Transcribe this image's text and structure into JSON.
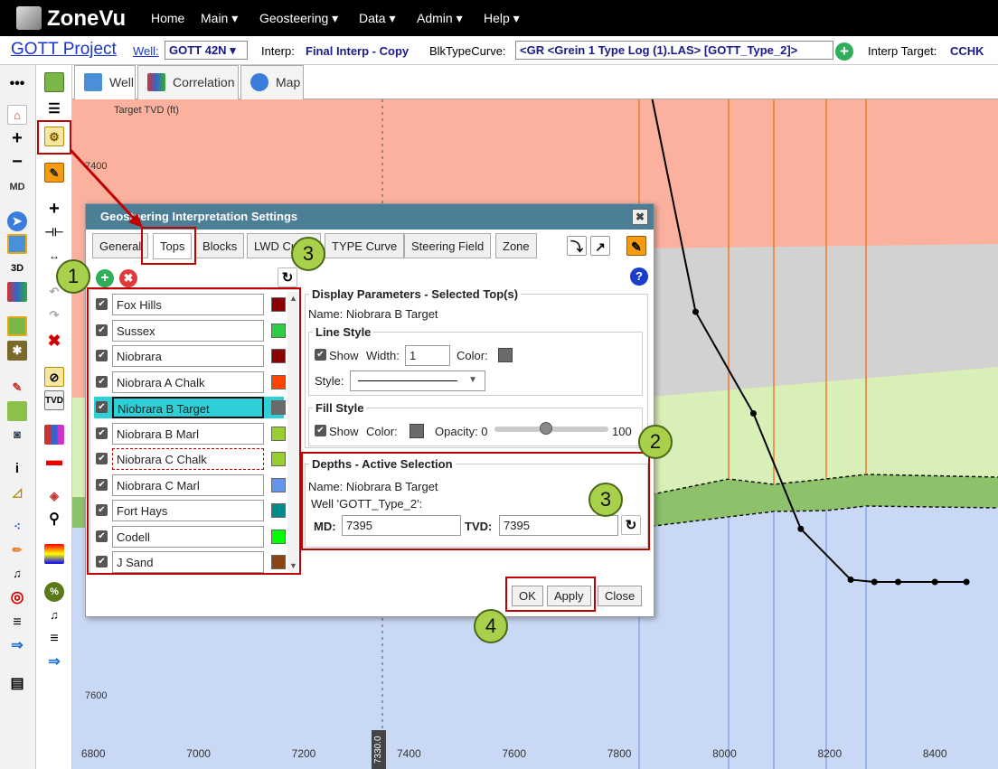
{
  "app": {
    "logo_text": "ZoneVu"
  },
  "nav": {
    "items": [
      "Home",
      "Main ▾",
      "Geosteering ▾",
      "Data ▾",
      "Admin ▾",
      "Help ▾"
    ]
  },
  "project": {
    "title": "GOTT Project",
    "well_label": "Well:",
    "well_value": "GOTT 42N",
    "interp_label": "Interp:",
    "interp_value": "Final Interp - Copy",
    "blk_label": "BlkTypeCurve:",
    "blk_value": "<GR <Grein 1 Type Log (1).LAS> [GOTT_Type_2]>",
    "target_label": "Interp Target:",
    "target_value": "CCHK"
  },
  "view_tabs": [
    "Well",
    "Correlation",
    "Map"
  ],
  "chart": {
    "axis_label": "Target TVD (ft)",
    "y_ticks": [
      "7400",
      "7600"
    ],
    "x_ticks": [
      "6800",
      "7000",
      "7200",
      "7400",
      "7600",
      "7800",
      "8000",
      "8200",
      "8400"
    ],
    "cursor_label": "7330.0",
    "colors": {
      "salmon": "#fbb19e",
      "gray": "#d2d2d2",
      "lightgreen": "#d9efb8",
      "green": "#8ec26a",
      "blue": "#c9d8f4",
      "orange_line": "#f07a2a"
    }
  },
  "chart_data": {
    "type": "line",
    "x": [
      7852,
      7945,
      8055,
      8145,
      8240,
      8285,
      8330,
      8400,
      8460
    ],
    "y": [
      7318,
      7422,
      7466,
      7516,
      7538,
      7539,
      7539,
      7539,
      7539
    ],
    "title": "",
    "xlabel": "",
    "ylabel": "Target TVD (ft)",
    "xlim": [
      6760,
      8520
    ],
    "ylim": [
      7330,
      7620
    ]
  },
  "dialog": {
    "title": "Geosteering Interpretation Settings",
    "close_label": "✖",
    "tabs": [
      "General",
      "Tops",
      "Blocks",
      "LWD Curve",
      "TYPE Curve",
      "Steering Field",
      "Zone"
    ],
    "tops": [
      {
        "name": "Fox Hills",
        "color": "#8b0000"
      },
      {
        "name": "Sussex",
        "color": "#2ecc40"
      },
      {
        "name": "Niobrara",
        "color": "#8b0000"
      },
      {
        "name": "Niobrara A Chalk",
        "color": "#ff4500"
      },
      {
        "name": "Niobrara B Target",
        "color": "#6b6b6b"
      },
      {
        "name": "Niobrara B Marl",
        "color": "#9acd32"
      },
      {
        "name": "Niobrara C Chalk",
        "color": "#9acd32"
      },
      {
        "name": "Niobrara C Marl",
        "color": "#6495ed"
      },
      {
        "name": "Fort Hays",
        "color": "#008b8b"
      },
      {
        "name": "Codell",
        "color": "#00ff00"
      },
      {
        "name": "J Sand",
        "color": "#8b4513"
      }
    ],
    "display": {
      "legend": "Display Parameters - Selected Top(s)",
      "name_line": "Name: Niobrara B Target",
      "line_style_legend": "Line Style",
      "show_label": "Show",
      "width_label": "Width:",
      "width_value": "1",
      "color_label": "Color:",
      "style_label": "Style:",
      "fill_style_legend": "Fill Style",
      "fill_show_label": "Show",
      "fill_color_label": "Color:",
      "opacity_label": "Opacity: 0",
      "opacity_max": "100",
      "opacity_value": 0.45
    },
    "depths": {
      "legend": "Depths - Active Selection",
      "name_line": "Name: Niobrara B Target",
      "well_line": "Well 'GOTT_Type_2':",
      "md_label": "MD:",
      "md_value": "7395",
      "tvd_label": "TVD:",
      "tvd_value": "7395"
    },
    "buttons": {
      "ok": "OK",
      "apply": "Apply",
      "close": "Close"
    }
  },
  "callouts": [
    "1",
    "2",
    "3",
    "3",
    "4"
  ]
}
